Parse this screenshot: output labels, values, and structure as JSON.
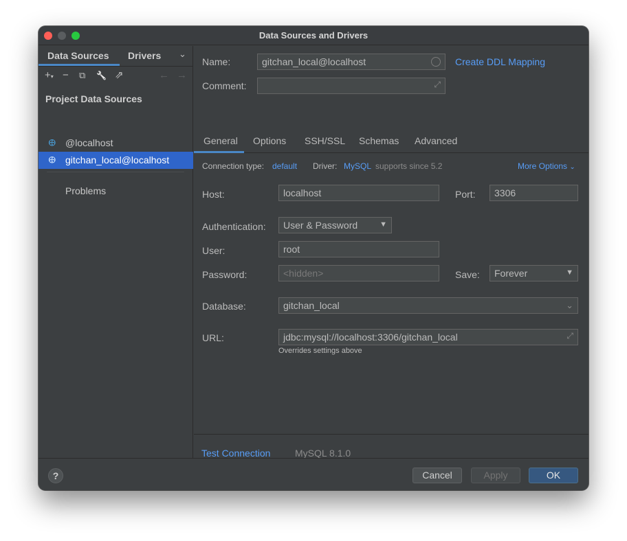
{
  "window": {
    "title": "Data Sources and Drivers"
  },
  "sidebar": {
    "tabs": [
      "Data Sources",
      "Drivers"
    ],
    "tab_chevron": "⌄",
    "toolbar": {
      "add": "+",
      "add_sub": "▾",
      "remove": "−",
      "duplicate": "⧉",
      "wrench": "🔧",
      "export": "⇗",
      "back": "←",
      "forward": "→"
    },
    "section_title": "Project Data Sources",
    "items": [
      {
        "label": "@localhost",
        "icon": "dolphin-icon"
      },
      {
        "label": "gitchan_local@localhost",
        "icon": "dolphin-icon",
        "selected": true
      }
    ],
    "problems_label": "Problems"
  },
  "form": {
    "name_label": "Name:",
    "name_value": "gitchan_local@localhost",
    "create_ddl": "Create DDL Mapping",
    "comment_label": "Comment:",
    "comment_value": "",
    "tabs": [
      "General",
      "Options",
      "SSH/SSL",
      "Schemas",
      "Advanced"
    ],
    "connection_type_label": "Connection type:",
    "connection_type_value": "default",
    "driver_label": "Driver:",
    "driver_value": "MySQL",
    "driver_note": "supports since 5.2",
    "more_options": "More Options",
    "host_label": "Host:",
    "host_value": "localhost",
    "port_label": "Port:",
    "port_value": "3306",
    "auth_label": "Authentication:",
    "auth_value": "User & Password",
    "user_label": "User:",
    "user_value": "root",
    "password_label": "Password:",
    "password_placeholder": "<hidden>",
    "save_label": "Save:",
    "save_value": "Forever",
    "database_label": "Database:",
    "database_value": "gitchan_local",
    "url_label": "URL:",
    "url_value": "jdbc:mysql://localhost:3306/gitchan_local",
    "url_hint": "Overrides settings above",
    "test_connection": "Test Connection",
    "server_version": "MySQL 8.1.0"
  },
  "footer": {
    "help": "?",
    "cancel": "Cancel",
    "apply": "Apply",
    "ok": "OK"
  },
  "colors": {
    "background": "#3c3f41",
    "accent_link": "#589df6",
    "selection": "#2f65ca",
    "primary_button": "#365880"
  }
}
